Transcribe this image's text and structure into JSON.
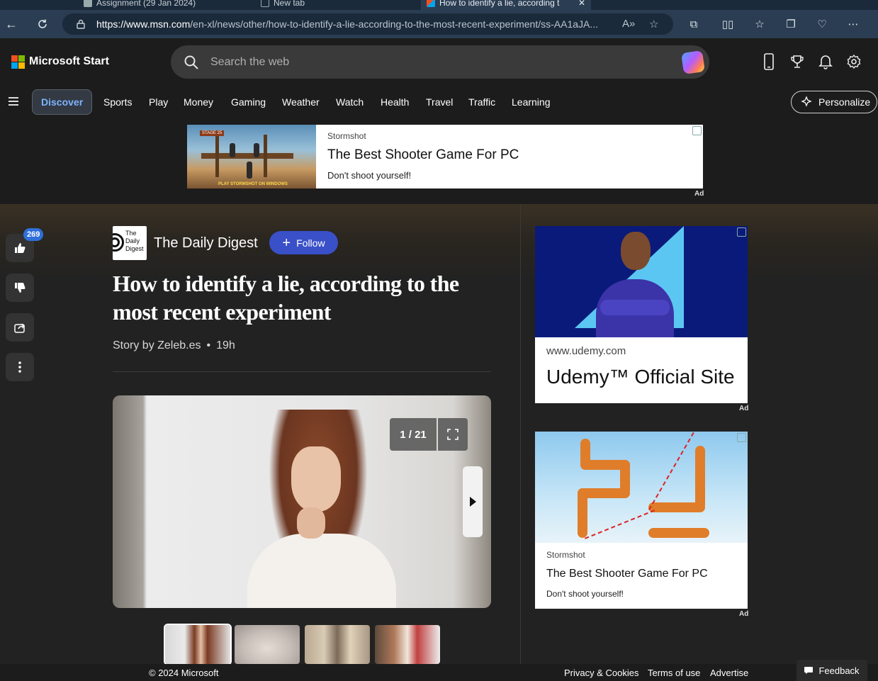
{
  "browser": {
    "tabs": [
      {
        "label": "Assignment (29 Jan 2024)"
      },
      {
        "label": "New tab"
      },
      {
        "label": "How to identify a lie, according t"
      }
    ],
    "url_domain": "https://www.msn.com",
    "url_path": "/en-xl/news/other/how-to-identify-a-lie-according-to-the-most-recent-experiment/ss-AA1aJA..."
  },
  "header": {
    "brand": "Microsoft Start",
    "search_placeholder": "Search the web"
  },
  "nav": {
    "items": [
      "Discover",
      "Sports",
      "Play",
      "Money",
      "Gaming",
      "Weather",
      "Watch",
      "Health",
      "Travel",
      "Traffic",
      "Learning"
    ],
    "personalize": "Personalize"
  },
  "top_ad": {
    "source": "Stormshot",
    "title": "The Best Shooter Game For PC",
    "description": "Don't shoot yourself!",
    "label": "Ad",
    "image_caption": "PLAY STORMSHOT ON WINDOWS",
    "image_stage": "STAGE 25"
  },
  "article": {
    "like_count": "269",
    "publisher_logo": "The Daily Digest",
    "publisher": "The Daily Digest",
    "follow_label": "Follow",
    "title": "How to identify a lie, according to the most recent experiment",
    "byline": "Story by Zeleb.es",
    "age": "19h",
    "slide_counter": "1 / 21"
  },
  "rail_ads": [
    {
      "source": "www.udemy.com",
      "title": "Udemy™ Official Site",
      "label": "Ad"
    },
    {
      "source": "Stormshot",
      "title": "The Best Shooter Game For PC",
      "description": "Don't shoot yourself!",
      "label": "Ad"
    }
  ],
  "footer": {
    "copyright": "© 2024 Microsoft",
    "links": [
      "Privacy & Cookies",
      "Terms of use",
      "Advertise"
    ],
    "feedback": "Feedback"
  },
  "colors": {
    "accent": "#3a50c8",
    "active_nav_text": "#7db4ff",
    "browser_chrome": "#2b3d52"
  }
}
